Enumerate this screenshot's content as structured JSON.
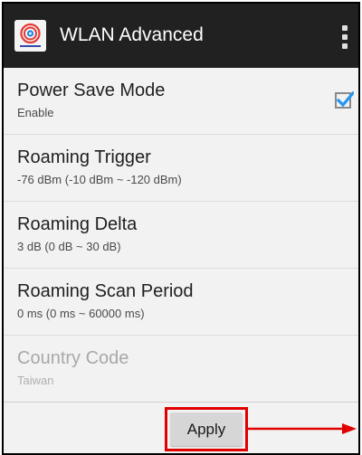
{
  "app": {
    "title": "WLAN Advanced",
    "icon": "wifi-advanced-app-icon",
    "menu_icon": "overflow-menu-icon"
  },
  "settings": [
    {
      "title": "Power Save Mode",
      "summary": "Enable",
      "control": "checkbox",
      "checked": true,
      "enabled": true
    },
    {
      "title": "Roaming Trigger",
      "summary": "-76 dBm  (-10 dBm ~ -120 dBm)",
      "enabled": true
    },
    {
      "title": "Roaming Delta",
      "summary": "3 dB  (0 dB ~ 30 dB)",
      "enabled": true
    },
    {
      "title": "Roaming Scan Period",
      "summary": "0 ms (0 ms ~ 60000 ms)",
      "enabled": true
    },
    {
      "title": "Country Code",
      "summary": "Taiwan",
      "enabled": false
    }
  ],
  "footer": {
    "apply_label": "Apply"
  },
  "colors": {
    "appbar": "#212121",
    "checkbox": "#2196f3",
    "highlight": "#e00000",
    "background": "#f2f2f2"
  }
}
